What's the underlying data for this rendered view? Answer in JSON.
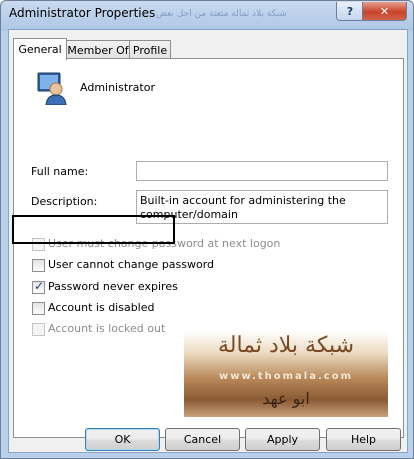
{
  "window": {
    "title": "Administrator Properties",
    "watermark_text": "شبكة بلاد ثمالة متعتة من اجل بعض",
    "help_label": "?",
    "close_label": "✕"
  },
  "tabs": [
    {
      "label": "General",
      "active": true
    },
    {
      "label": "Member Of",
      "active": false
    },
    {
      "label": "Profile",
      "active": false
    }
  ],
  "user": {
    "icon": "user-icon",
    "name": "Administrator"
  },
  "form": {
    "full_name_label": "Full name:",
    "full_name_value": "",
    "description_label": "Description:",
    "description_line1": "Built-in account for administering the",
    "description_line2": "computer/domain"
  },
  "checkboxes": [
    {
      "label": "User must change password at next logon",
      "checked": false,
      "enabled": false
    },
    {
      "label": "User cannot change password",
      "checked": false,
      "enabled": true
    },
    {
      "label": "Password never expires",
      "checked": true,
      "enabled": true
    },
    {
      "label": "Account is disabled",
      "checked": false,
      "enabled": true
    },
    {
      "label": "Account is locked out",
      "checked": false,
      "enabled": false
    }
  ],
  "banner": {
    "arabic_title": "شبكة بلاد ثمالة",
    "url": "www.thomala.com",
    "signature": "ابو عهد"
  },
  "buttons": {
    "ok": "OK",
    "cancel": "Cancel",
    "apply": "Apply",
    "help": "Help"
  }
}
